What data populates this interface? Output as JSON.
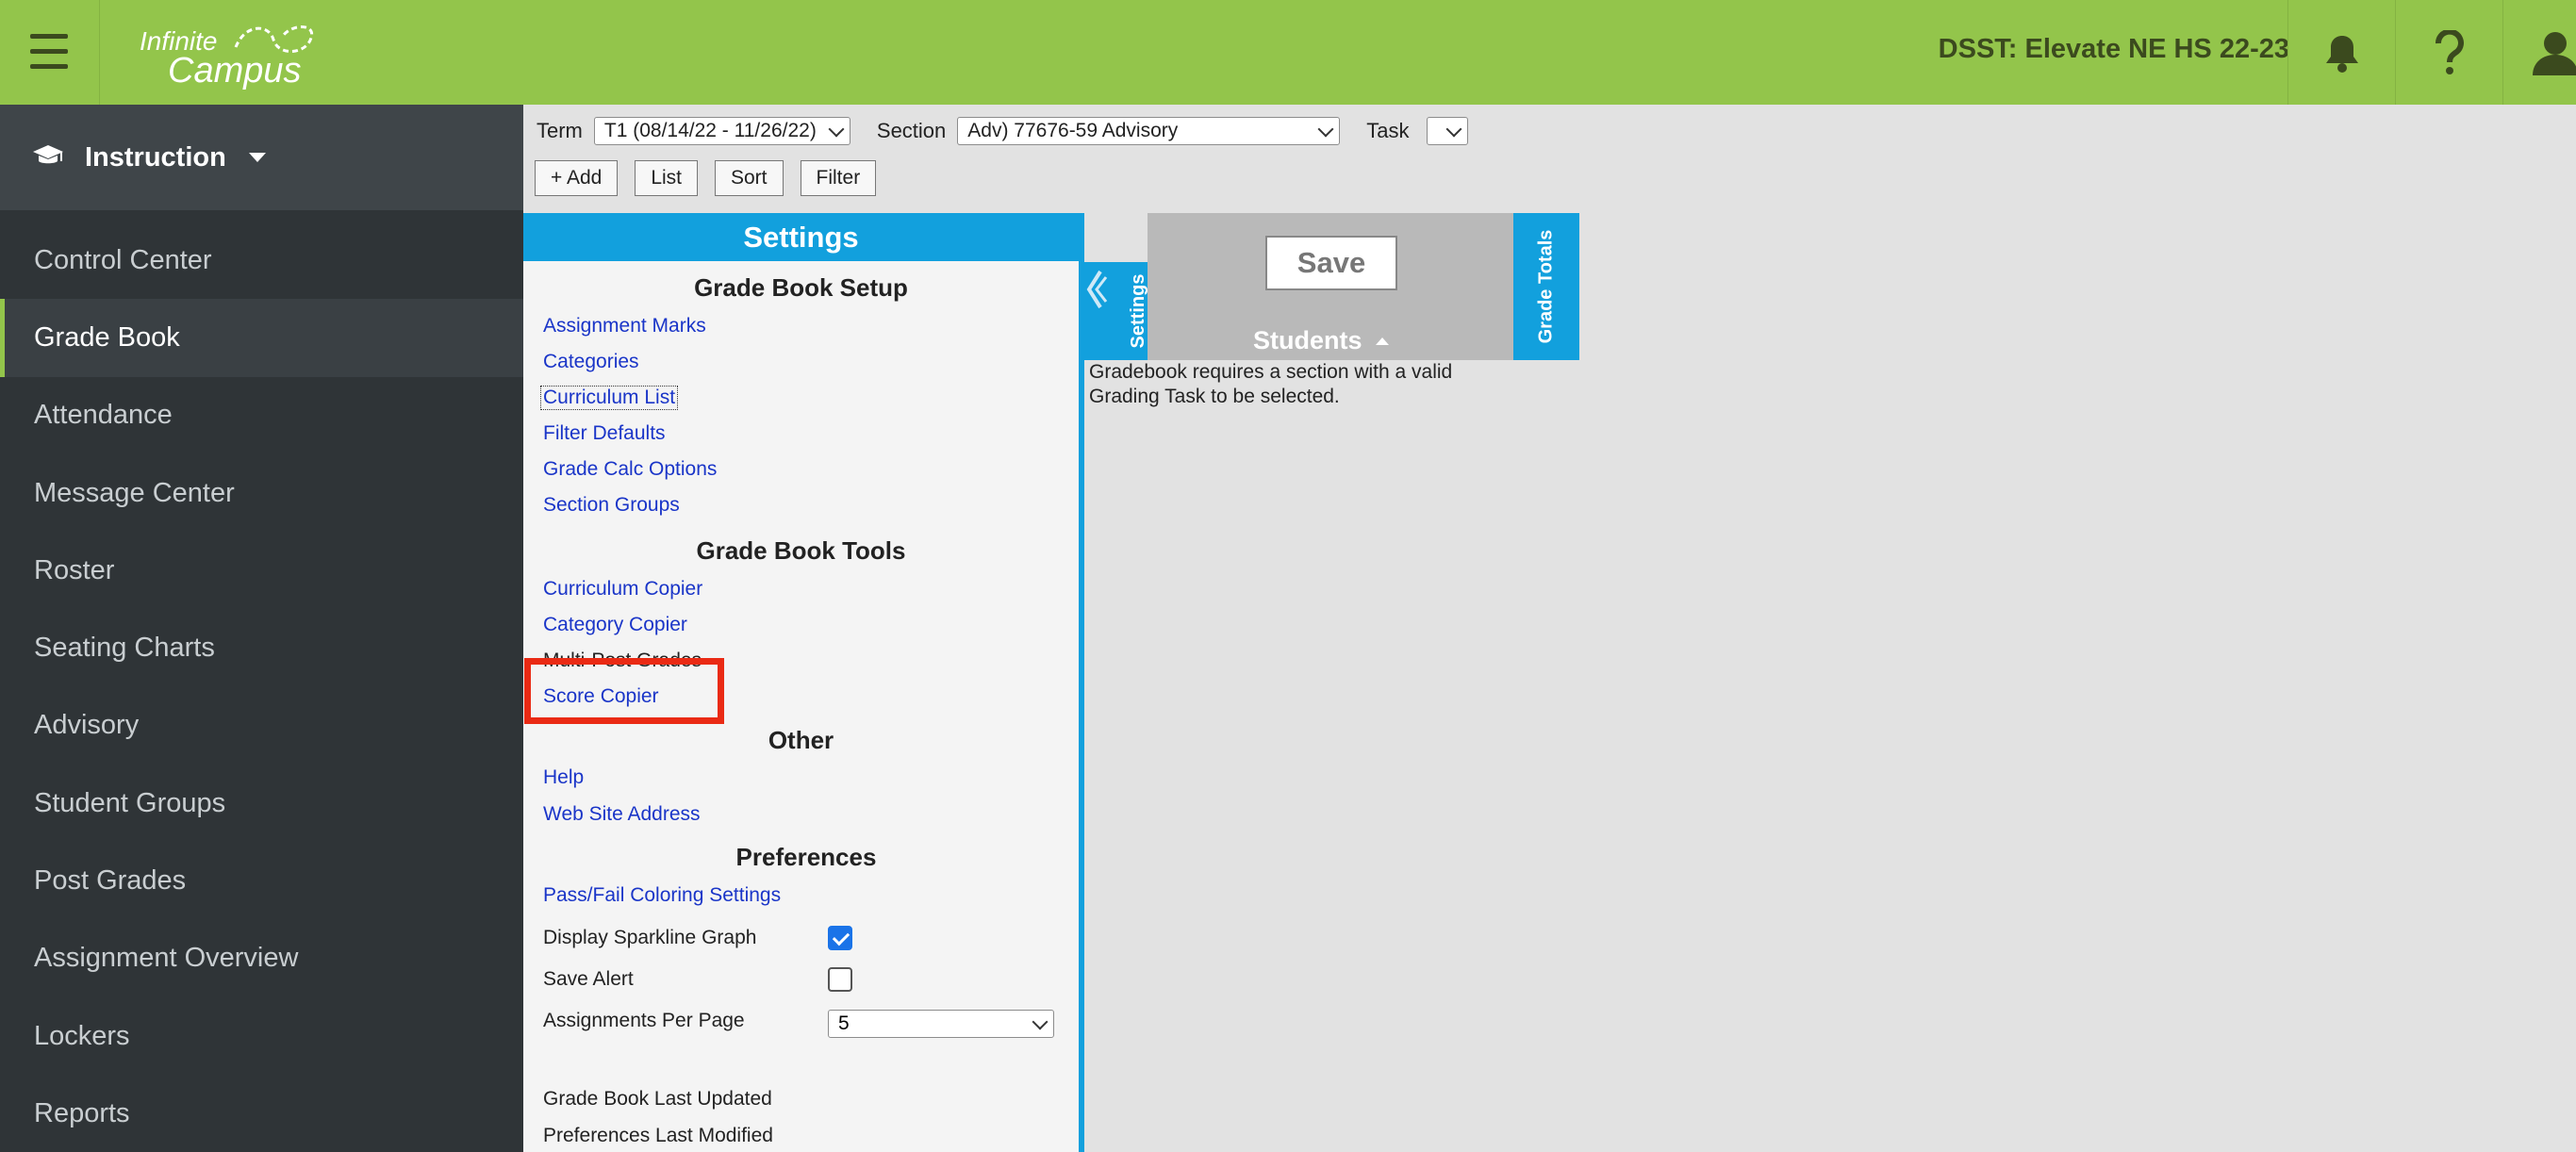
{
  "header": {
    "logo_line1": "Infinite",
    "logo_line2": "Campus",
    "school": "DSST: Elevate NE HS 22-23"
  },
  "icons": {
    "menu": "hamburger-icon",
    "notifications": "bell-icon",
    "help": "question-icon",
    "user": "user-icon",
    "instruction": "graduation-cap-icon"
  },
  "sidebar": {
    "module": "Instruction",
    "items": [
      {
        "label": "Control Center"
      },
      {
        "label": "Grade Book"
      },
      {
        "label": "Attendance"
      },
      {
        "label": "Message Center"
      },
      {
        "label": "Roster"
      },
      {
        "label": "Seating Charts"
      },
      {
        "label": "Advisory"
      },
      {
        "label": "Student Groups"
      },
      {
        "label": "Post Grades"
      },
      {
        "label": "Assignment Overview"
      },
      {
        "label": "Lockers"
      },
      {
        "label": "Reports"
      }
    ]
  },
  "toolbar": {
    "term_label": "Term",
    "term_value": "T1 (08/14/22 - 11/26/22)",
    "section_label": "Section",
    "section_value": "Adv) 77676-59 Advisory",
    "task_label": "Task",
    "task_value": "",
    "buttons": [
      "+ Add",
      "List",
      "Sort",
      "Filter"
    ]
  },
  "settings": {
    "title": "Settings",
    "setup_title": "Grade Book Setup",
    "setup_links": [
      "Assignment Marks",
      "Categories",
      "Curriculum List",
      "Filter Defaults",
      "Grade Calc Options",
      "Section Groups"
    ],
    "tools_title": "Grade Book Tools",
    "tools_links": [
      "Curriculum Copier",
      "Category Copier",
      "Multi-Post Grades",
      "Score Copier"
    ],
    "other_title": "Other",
    "other_links": [
      "Help",
      "Web Site Address"
    ],
    "prefs_title": "Preferences",
    "prefs_link": "Pass/Fail Coloring Settings",
    "sparkline_label": "Display Sparkline Graph",
    "sparkline_checked": true,
    "save_alert_label": "Save Alert",
    "save_alert_checked": false,
    "per_page_label": "Assignments Per Page",
    "per_page_value": "5",
    "last_updated_label": "Grade Book Last Updated",
    "prefs_modified_label": "Preferences Last Modified"
  },
  "grade": {
    "settings_tab": "Settings",
    "save": "Save",
    "students": "Students",
    "totals_tab": "Grade Totals",
    "message": "Gradebook requires a section with a valid Grading Task to be selected."
  },
  "colors": {
    "header_green": "#93c54b",
    "sidebar_dark": "#2f3437",
    "accent_blue": "#12a0dd",
    "highlight_red": "#ea2a14",
    "link_blue": "#1a35c8"
  }
}
